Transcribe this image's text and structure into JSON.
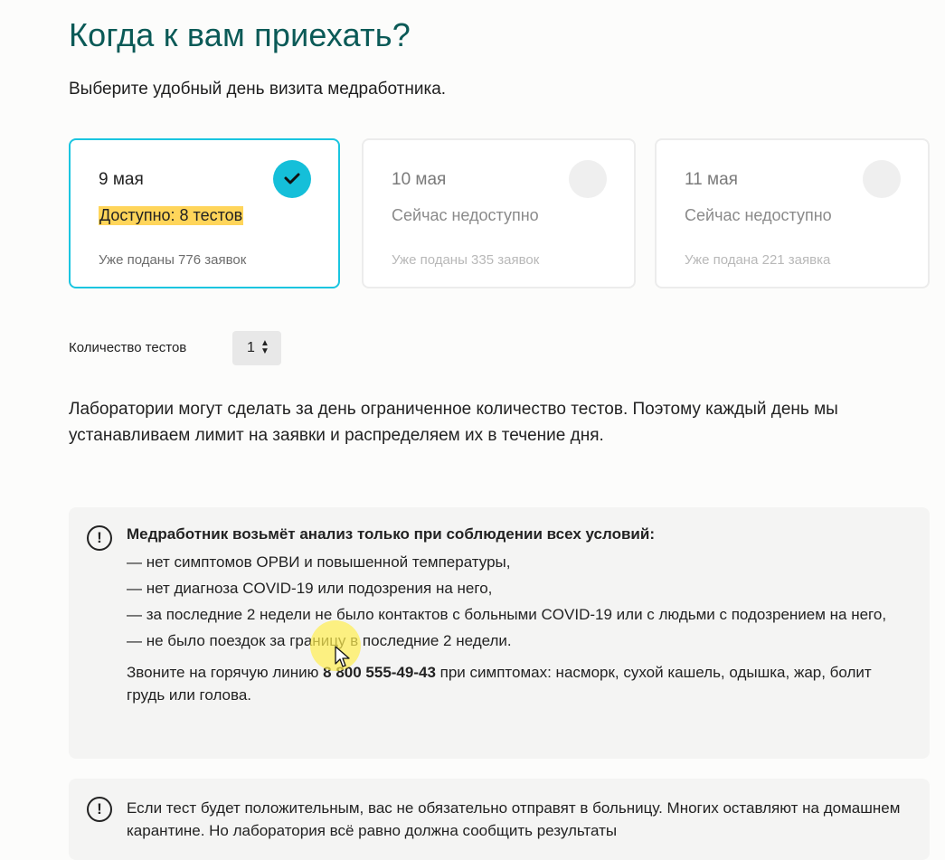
{
  "heading": "Когда к вам приехать?",
  "subtitle": "Выберите удобный день визита медработника.",
  "days": [
    {
      "date": "9 мая",
      "status": "Доступно: 8 тестов",
      "count": "Уже поданы 776 заявок",
      "selected": true
    },
    {
      "date": "10 мая",
      "status": "Сейчас недоступно",
      "count": "Уже поданы 335 заявок",
      "selected": false
    },
    {
      "date": "11 мая",
      "status": "Сейчас недоступно",
      "count": "Уже подана 221 заявка",
      "selected": false
    }
  ],
  "quantity": {
    "label": "Количество тестов",
    "value": "1",
    "arrows": "▲▼"
  },
  "info_text": "Лаборатории могут сделать за день ограниченное количество тестов. Поэтому каждый день мы устанавливаем лимит на заявки и распределяем их в течение дня.",
  "notice1": {
    "icon": "!",
    "title": "Медработник возьмёт анализ только при соблюдении всех условий:",
    "conditions": [
      "— нет симптомов ОРВИ и повышенной температуры,",
      "— нет диагноза COVID-19 или подозрения на него,",
      "— за последние 2 недели не было контактов с больными COVID-19 или с людьми с подозрением на него,",
      "— не было поездок за границу в последние 2 недели."
    ],
    "hotline_prefix": "Звоните на горячую линию ",
    "hotline_number": "8 800 555-49-43",
    "hotline_suffix": " при симптомах: насморк, сухой кашель, одышка, жар, болит грудь или голова."
  },
  "notice2": {
    "icon": "!",
    "text": "Если тест будет положительным, вас не обязательно отправят в больницу. Многих оставляют на домашнем карантине. Но лаборатория всё равно должна сообщить результаты"
  },
  "colors": {
    "heading": "#0b5a57",
    "accent": "#15bfd9",
    "highlight": "#ffd55a",
    "notice_bg": "#f4f4f3"
  }
}
